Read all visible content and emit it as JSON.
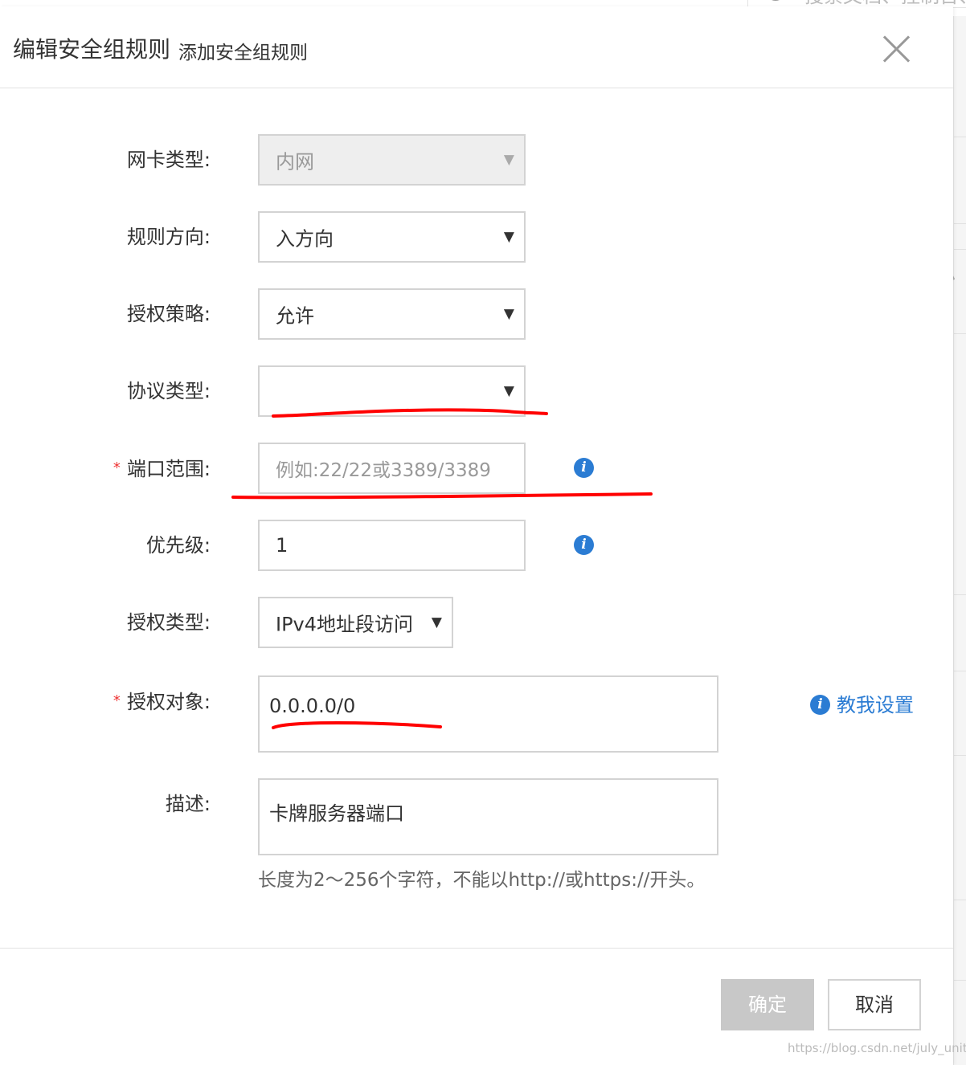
{
  "background": {
    "search_placeholder": "搜索文档、控制台、"
  },
  "dialog": {
    "title": "编辑安全组规则",
    "subtitle": "添加安全组规则"
  },
  "form": {
    "nic_type": {
      "label": "网卡类型:",
      "value": "内网"
    },
    "direction": {
      "label": "规则方向:",
      "value": "入方向"
    },
    "policy": {
      "label": "授权策略:",
      "value": "允许"
    },
    "protocol": {
      "label": "协议类型:",
      "value": ""
    },
    "port_range": {
      "label": "端口范围:",
      "required_mark": "*",
      "placeholder": "例如:22/22或3389/3389"
    },
    "priority": {
      "label": "优先级:",
      "value": "1"
    },
    "auth_type": {
      "label": "授权类型:",
      "value": "IPv4地址段访问"
    },
    "auth_object": {
      "label": "授权对象:",
      "required_mark": "*",
      "value": "0.0.0.0/0",
      "help_link": "教我设置"
    },
    "description": {
      "label": "描述:",
      "value": "卡牌服务器端口",
      "hint": "长度为2～256个字符，不能以http://或https://开头。"
    }
  },
  "buttons": {
    "ok": "确定",
    "cancel": "取消"
  },
  "watermark": "https://blog.csdn.net/july_unity",
  "colors": {
    "link": "#2b7cd3",
    "required": "#ee3333",
    "annotation": "#ff0000",
    "disabled_button": "#c8c8c8"
  }
}
